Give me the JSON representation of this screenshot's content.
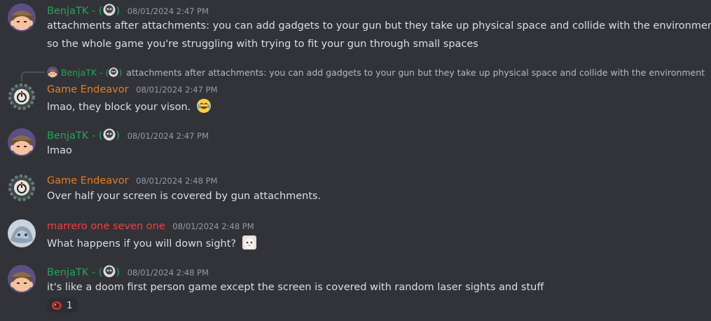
{
  "colors": {
    "benja": "#23a55a",
    "game": "#e67e22",
    "marrero": "#f23f43",
    "bg": "#313338"
  },
  "reply": {
    "author": "BenjaTK - (",
    "author_suffix": ")",
    "text": "attachments after attachments: you can add gadgets to your gun but they take up physical space and collide with the environment"
  },
  "messages": [
    {
      "author": "BenjaTK - (",
      "author_suffix": ")",
      "timestamp": "08/01/2024 2:47 PM",
      "lines": [
        "attachments after attachments: you can add gadgets to your gun but they take up physical space and collide with the environment",
        "so the whole game you're struggling with trying to fit your gun through small spaces"
      ]
    },
    {
      "author": "Game Endeavor",
      "timestamp": "08/01/2024 2:47 PM",
      "lines": [
        "lmao, they block your vison."
      ],
      "emoji": "joy-emoji"
    },
    {
      "author": "BenjaTK - (",
      "author_suffix": ")",
      "timestamp": "08/01/2024 2:47 PM",
      "lines": [
        "lmao"
      ]
    },
    {
      "author": "Game Endeavor",
      "timestamp": "08/01/2024 2:48 PM",
      "lines": [
        "Over half your screen is covered by gun attachments."
      ]
    },
    {
      "author": "marrero one seven one",
      "timestamp": "08/01/2024 2:48 PM",
      "lines": [
        "What happens if you will down sight?"
      ],
      "emoji": "custom-emoji"
    },
    {
      "author": "BenjaTK - (",
      "author_suffix": ")",
      "timestamp": "08/01/2024 2:48 PM",
      "lines": [
        "it's like a doom first person game except the screen is covered with random laser sights and stuff"
      ],
      "reaction": {
        "icon": "reaction-emoji",
        "count": "1"
      }
    }
  ]
}
